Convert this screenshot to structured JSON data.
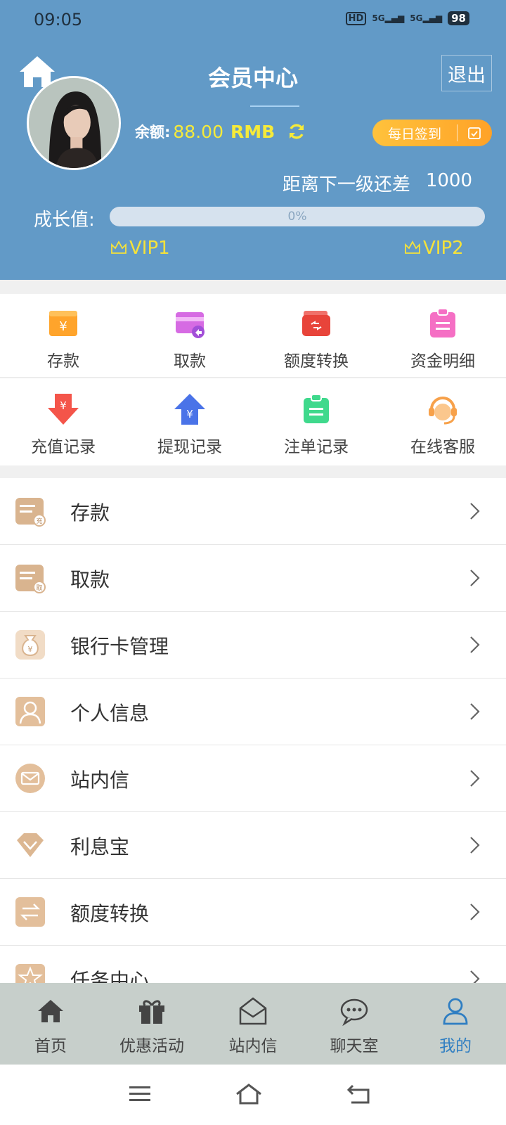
{
  "status_bar": {
    "time": "09:05",
    "hd": "HD",
    "signal1": "5G",
    "signal2": "5G",
    "battery": "98"
  },
  "header": {
    "title": "会员中心",
    "logout_label": "退出",
    "balance_label": "余额:",
    "balance_value": "88.00",
    "balance_unit": "RMB",
    "checkin_label": "每日签到",
    "next_level_label": "距离下一级还差",
    "next_level_value": "1000",
    "growth_label": "成长值:",
    "progress": 0,
    "progress_text": "0%",
    "vip_current": "VIP1",
    "vip_next": "VIP2",
    "colors": {
      "header_bg": "#629ac7",
      "accent_yellow": "#f5ea3a",
      "checkin_orange": "#ffa227"
    }
  },
  "quick_grid": {
    "row1": [
      {
        "label": "存款",
        "icon": "deposit-icon"
      },
      {
        "label": "取款",
        "icon": "withdraw-card-icon"
      },
      {
        "label": "额度转换",
        "icon": "transfer-wallet-icon"
      },
      {
        "label": "资金明细",
        "icon": "fund-detail-icon"
      }
    ],
    "row2": [
      {
        "label": "充值记录",
        "icon": "recharge-record-icon"
      },
      {
        "label": "提现记录",
        "icon": "withdraw-record-icon"
      },
      {
        "label": "注单记录",
        "icon": "bet-record-icon"
      },
      {
        "label": "在线客服",
        "icon": "customer-service-icon"
      }
    ]
  },
  "menu_list": [
    {
      "label": "存款",
      "icon": "deposit-list-icon"
    },
    {
      "label": "取款",
      "icon": "withdraw-list-icon"
    },
    {
      "label": "银行卡管理",
      "icon": "bank-card-icon"
    },
    {
      "label": "个人信息",
      "icon": "person-icon"
    },
    {
      "label": "站内信",
      "icon": "mail-icon"
    },
    {
      "label": "利息宝",
      "icon": "interest-icon"
    },
    {
      "label": "额度转换",
      "icon": "transfer-icon"
    },
    {
      "label": "任务中心",
      "icon": "task-icon"
    }
  ],
  "bottom_nav": [
    {
      "label": "首页",
      "icon": "home-icon"
    },
    {
      "label": "优惠活动",
      "icon": "gift-icon"
    },
    {
      "label": "站内信",
      "icon": "envelope-icon"
    },
    {
      "label": "聊天室",
      "icon": "chat-icon"
    },
    {
      "label": "我的",
      "icon": "user-icon",
      "active": true
    }
  ]
}
